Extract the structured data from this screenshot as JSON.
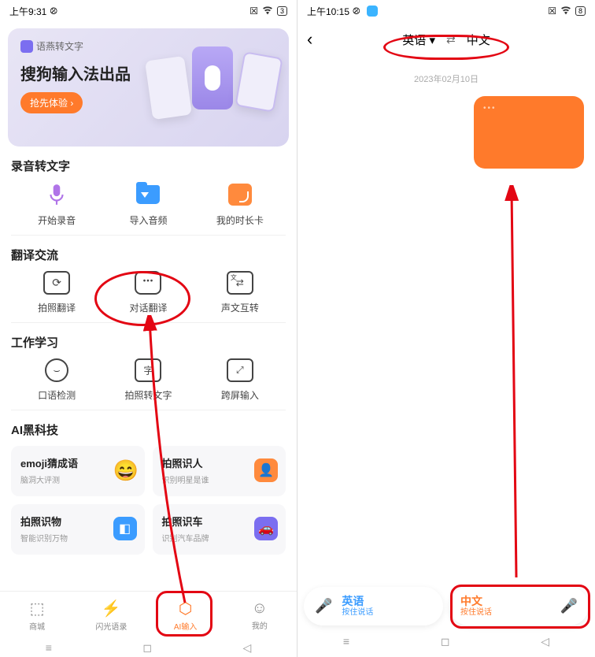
{
  "left": {
    "status": {
      "time": "上午9:31"
    },
    "banner": {
      "tag": "语燕转文字",
      "title": "搜狗输入法出品",
      "cta": "抢先体验"
    },
    "sections": {
      "record": {
        "title": "录音转文字",
        "items": [
          "开始录音",
          "导入音频",
          "我的时长卡"
        ]
      },
      "translate": {
        "title": "翻译交流",
        "items": [
          "拍照翻译",
          "对话翻译",
          "声文互转"
        ]
      },
      "work": {
        "title": "工作学习",
        "items": [
          "口语检测",
          "拍照转文字",
          "跨屏输入"
        ]
      },
      "ai": {
        "title": "AI黑科技",
        "cards": [
          {
            "t": "emoji猜成语",
            "s": "脑洞大评测"
          },
          {
            "t": "拍照识人",
            "s": "识别明星是谁"
          },
          {
            "t": "拍照识物",
            "s": "智能识别万物"
          },
          {
            "t": "拍照识车",
            "s": "识别汽车品牌"
          }
        ]
      }
    },
    "tabs": [
      "商城",
      "闪光语录",
      "AI输入",
      "我的"
    ]
  },
  "right": {
    "status": {
      "time": "上午10:15"
    },
    "lang": {
      "from": "英语",
      "to": "中文"
    },
    "date": "2023年02月10日",
    "talk": {
      "blue": {
        "lang": "英语",
        "hint": "按住说话"
      },
      "orange": {
        "lang": "中文",
        "hint": "按住说话"
      }
    }
  }
}
